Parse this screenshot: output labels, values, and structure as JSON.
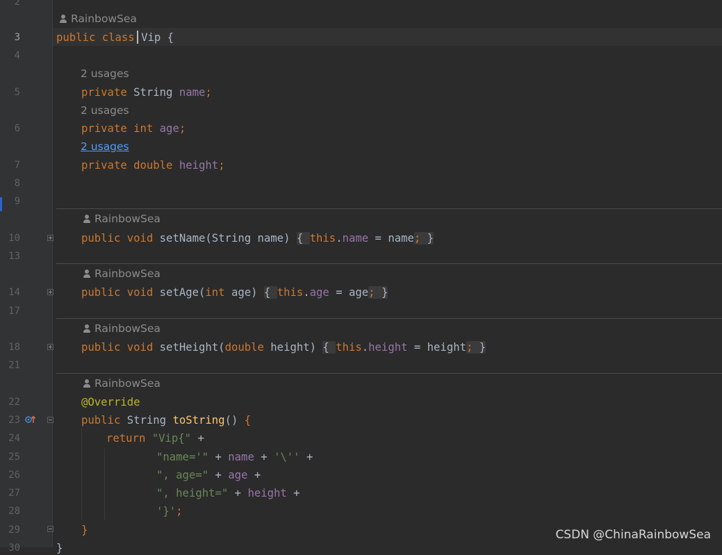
{
  "line_numbers": [
    "2",
    "3",
    "4",
    "5",
    "6",
    "7",
    "8",
    "9",
    "10",
    "13",
    "14",
    "17",
    "18",
    "21",
    "22",
    "23",
    "24",
    "25",
    "26",
    "27",
    "28",
    "29",
    "30"
  ],
  "author": "RainbowSea",
  "usages": "2 usages",
  "code": {
    "class_decl": {
      "public": "public",
      "class": "class",
      "name": "Vip",
      "brace": "{"
    },
    "fields": [
      {
        "mod": "private",
        "type": "String",
        "name": "name"
      },
      {
        "mod": "private",
        "type": "int",
        "name": "age"
      },
      {
        "mod": "private",
        "type": "double",
        "name": "height"
      }
    ],
    "setters": [
      {
        "name": "setName",
        "ptype": "String",
        "param": "name"
      },
      {
        "name": "setAge",
        "ptype": "int",
        "param": "age"
      },
      {
        "name": "setHeight",
        "ptype": "double",
        "param": "height"
      }
    ],
    "annotation": "@Override",
    "tostring_sig": "toString",
    "return_kw": "return",
    "s_vip": "\"Vip{\"",
    "s_name": "\"name='\"",
    "s_quote": "'\\''",
    "s_age": "\", age=\"",
    "s_height": "\", height=\"",
    "s_close": "'}'"
  },
  "watermark": "CSDN @ChinaRainbowSea",
  "colors": {
    "background": "#2b2b2b",
    "keyword": "#cc7832",
    "field": "#9876aa",
    "string": "#6a8759",
    "annotation": "#bbb529",
    "method": "#ffc66d"
  }
}
